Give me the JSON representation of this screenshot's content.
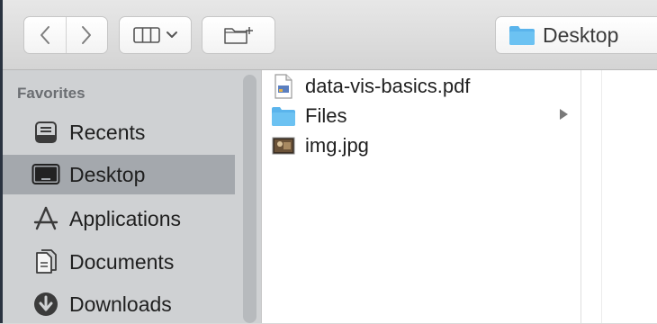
{
  "toolbar": {
    "back_icon": "chevron-left-icon",
    "forward_icon": "chevron-right-icon",
    "view_icon": "column-view-icon",
    "new_folder_icon": "new-folder-icon",
    "path_label": "Desktop"
  },
  "sidebar": {
    "heading": "Favorites",
    "items": [
      {
        "label": "Recents",
        "icon": "recents-icon",
        "selected": false
      },
      {
        "label": "Desktop",
        "icon": "desktop-icon",
        "selected": true
      },
      {
        "label": "Applications",
        "icon": "applications-icon",
        "selected": false
      },
      {
        "label": "Documents",
        "icon": "documents-icon",
        "selected": false
      },
      {
        "label": "Downloads",
        "icon": "downloads-icon",
        "selected": false
      }
    ]
  },
  "files": [
    {
      "name": "data-vis-basics.pdf",
      "icon": "pdf-file-icon",
      "is_folder": false
    },
    {
      "name": "Files",
      "icon": "folder-icon",
      "is_folder": true
    },
    {
      "name": "img.jpg",
      "icon": "image-file-icon",
      "is_folder": false
    }
  ],
  "colors": {
    "folder_blue": "#5ab4ec",
    "selection_gray": "#a4a8ad",
    "sidebar_bg": "#cfd1d3"
  }
}
